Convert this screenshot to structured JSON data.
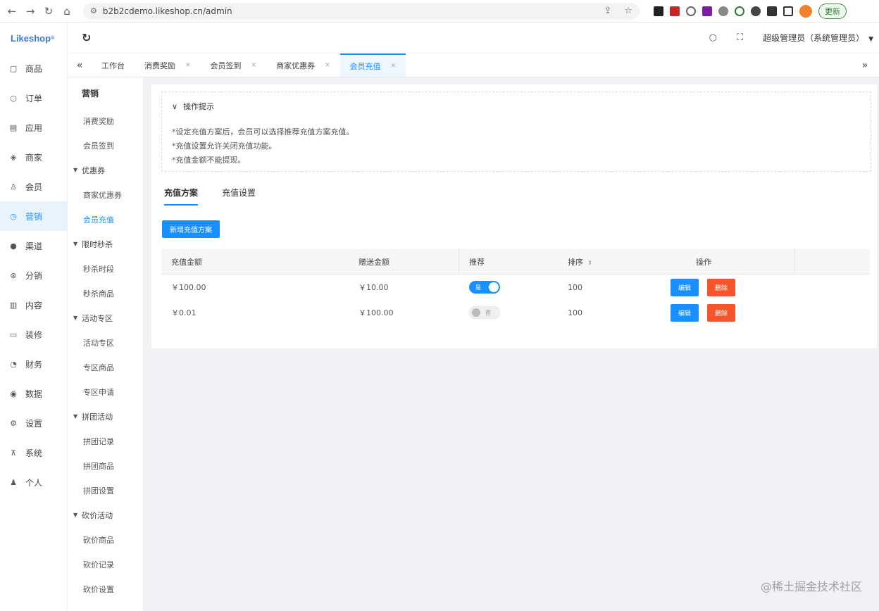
{
  "browser": {
    "url": "b2b2cdemo.likeshop.cn/admin",
    "update_label": "更新"
  },
  "logo": "Likeshop",
  "sidebar": {
    "items": [
      {
        "label": "商品",
        "icon": "goods-icon"
      },
      {
        "label": "订单",
        "icon": "order-icon"
      },
      {
        "label": "应用",
        "icon": "apps-icon"
      },
      {
        "label": "商家",
        "icon": "shop-icon"
      },
      {
        "label": "会员",
        "icon": "member-icon"
      },
      {
        "label": "营销",
        "icon": "marketing-icon",
        "active": true
      },
      {
        "label": "渠道",
        "icon": "channel-icon"
      },
      {
        "label": "分销",
        "icon": "distribution-icon"
      },
      {
        "label": "内容",
        "icon": "content-icon"
      },
      {
        "label": "装修",
        "icon": "decoration-icon"
      },
      {
        "label": "财务",
        "icon": "finance-icon"
      },
      {
        "label": "数据",
        "icon": "data-icon"
      },
      {
        "label": "设置",
        "icon": "settings-icon"
      },
      {
        "label": "系统",
        "icon": "system-icon"
      },
      {
        "label": "个人",
        "icon": "person-icon"
      }
    ]
  },
  "subsidebar": {
    "title": "营销",
    "entries": [
      {
        "type": "item",
        "label": "消费奖励"
      },
      {
        "type": "item",
        "label": "会员签到"
      },
      {
        "type": "group",
        "label": "优惠券"
      },
      {
        "type": "item",
        "label": "商家优惠券"
      },
      {
        "type": "item",
        "label": "会员充值",
        "active": true
      },
      {
        "type": "group",
        "label": "限时秒杀"
      },
      {
        "type": "item",
        "label": "秒杀时段"
      },
      {
        "type": "item",
        "label": "秒杀商品"
      },
      {
        "type": "group",
        "label": "活动专区"
      },
      {
        "type": "item",
        "label": "活动专区"
      },
      {
        "type": "item",
        "label": "专区商品"
      },
      {
        "type": "item",
        "label": "专区申请"
      },
      {
        "type": "group",
        "label": "拼团活动"
      },
      {
        "type": "item",
        "label": "拼团记录"
      },
      {
        "type": "item",
        "label": "拼团商品"
      },
      {
        "type": "item",
        "label": "拼团设置"
      },
      {
        "type": "group",
        "label": "砍价活动"
      },
      {
        "type": "item",
        "label": "砍价商品"
      },
      {
        "type": "item",
        "label": "砍价记录"
      },
      {
        "type": "item",
        "label": "砍价设置"
      }
    ]
  },
  "header": {
    "user": "超级管理员（系统管理员）"
  },
  "tabs": [
    {
      "label": "工作台",
      "closable": false
    },
    {
      "label": "消费奖励",
      "closable": true
    },
    {
      "label": "会员签到",
      "closable": true
    },
    {
      "label": "商家优惠券",
      "closable": true
    },
    {
      "label": "会员充值",
      "closable": true,
      "active": true
    }
  ],
  "tips": {
    "title": "操作提示",
    "lines": [
      "*设定充值方案后，会员可以选择推荐充值方案充值。",
      "*充值设置允许关闭充值功能。",
      "*充值金额不能提现。"
    ]
  },
  "inner_tabs": [
    "充值方案",
    "充值设置"
  ],
  "add_button": "新增充值方案",
  "table": {
    "headers": [
      "充值金额",
      "赠送金额",
      "推荐",
      "排序",
      "操作"
    ],
    "rows": [
      {
        "amount": "￥100.00",
        "bonus": "￥10.00",
        "recommend": "是",
        "recommend_on": true,
        "sort": "100"
      },
      {
        "amount": "￥0.01",
        "bonus": "￥100.00",
        "recommend": "否",
        "recommend_on": false,
        "sort": "100"
      }
    ],
    "edit_label": "编辑",
    "delete_label": "删除"
  },
  "watermark": "@稀土掘金技术社区"
}
